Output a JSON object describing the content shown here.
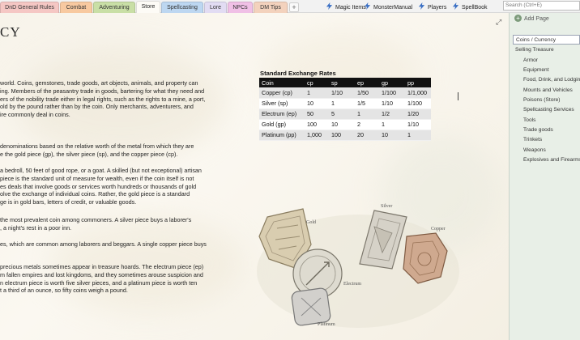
{
  "tabs": [
    {
      "label": "DnD General Rules",
      "color": "#f5c7c4"
    },
    {
      "label": "Combat",
      "color": "#f8c9a0"
    },
    {
      "label": "Adventuring",
      "color": "#c9dfa6"
    },
    {
      "label": "Store",
      "color": "#fdfbf6",
      "active": true
    },
    {
      "label": "Spellcasting",
      "color": "#bdd7f1"
    },
    {
      "label": "Lore",
      "color": "#e2dcf3"
    },
    {
      "label": "NPCs",
      "color": "#f0c0e6"
    },
    {
      "label": "DM Tips",
      "color": "#f3d2bd"
    }
  ],
  "add_tab_label": "+",
  "shortcuts": [
    {
      "label": "Magic Items",
      "icon": "lightning-icon"
    },
    {
      "label": "MonsterManual",
      "icon": "lightning-icon"
    },
    {
      "label": "Players",
      "icon": "lightning-icon"
    },
    {
      "label": "SpellBook",
      "icon": "lightning-icon"
    }
  ],
  "search": {
    "placeholder": "Search (Ctrl+E)"
  },
  "page": {
    "title": "CY",
    "paragraphs": [
      [
        "world. Coins, gemstones, trade goods, art objects, animals, and property can",
        "ing. Members of the peasantry trade in goods, bartering for what they need and",
        "ers of the nobility trade either in legal rights, such as the rights to a mine, a port,",
        "old by the pound rather than by the coin. Only merchants, adventurers, and",
        "ire commonly deal in coins."
      ],
      [
        "denominations based on the relative worth of the metal from which they are",
        "e the gold piece (gp), the silver piece (sp), and the copper piece (cp)."
      ],
      [
        "a bedroll, 50 feet of good rope, or a goat. A skilled (but not exceptional) artisan",
        "piece is the standard unit of measure for wealth, even if the coin itself is not",
        "es deals that involve goods or services worth hundreds or thousands of gold",
        "olve the exchange of individual coins. Rather, the gold piece is a standard",
        "ge is in gold bars, letters of credit, or valuable goods."
      ],
      [
        "the most prevalent coin among commoners. A silver piece buys a laborer's",
        ", a night's rest in a poor inn."
      ],
      [
        "es, which are common among laborers and beggars. A single copper piece buys"
      ],
      [
        "precious metals sometimes appear in treasure hoards. The electrum piece (ep)",
        "m fallen empires and lost kingdoms, and they sometimes arouse suspicion and",
        "n electrum piece is worth five silver pieces, and a platinum piece is worth ten",
        "t a third of an ounce, so fifty coins weigh a pound."
      ]
    ]
  },
  "exchange": {
    "title": "Standard Exchange Rates",
    "headers": [
      "Coin",
      "cp",
      "sp",
      "ep",
      "gp",
      "pp"
    ],
    "rows": [
      [
        "Copper (cp)",
        "1",
        "1/10",
        "1/50",
        "1/100",
        "1/1,000"
      ],
      [
        "Silver (sp)",
        "10",
        "1",
        "1/5",
        "1/10",
        "1/100"
      ],
      [
        "Electrum (ep)",
        "50",
        "5",
        "1",
        "1/2",
        "1/20"
      ],
      [
        "Gold (gp)",
        "100",
        "10",
        "2",
        "1",
        "1/10"
      ],
      [
        "Platinum (pp)",
        "1,000",
        "100",
        "20",
        "10",
        "1"
      ]
    ]
  },
  "coins_labels": {
    "gold": "Gold",
    "silver": "Silver",
    "copper": "Copper",
    "electrum": "Electrum",
    "platinum": "Platinum"
  },
  "sidebar": {
    "add_page": "Add Page",
    "items": [
      {
        "label": "Coins / Currency",
        "level": 0,
        "selected": true
      },
      {
        "label": "Selling Treasure",
        "level": 0
      },
      {
        "label": "Armor",
        "level": 1
      },
      {
        "label": "Equipment",
        "level": 1
      },
      {
        "label": "Food, Drink, and Lodging",
        "level": 1
      },
      {
        "label": "Mounts and Vehicles",
        "level": 1
      },
      {
        "label": "Poisons (Store)",
        "level": 1
      },
      {
        "label": "Spellcasting Services",
        "level": 1
      },
      {
        "label": "Tools",
        "level": 1
      },
      {
        "label": "Trade goods",
        "level": 1
      },
      {
        "label": "Trinkets",
        "level": 1
      },
      {
        "label": "Weapons",
        "level": 1
      },
      {
        "label": "Explosives and Firearms",
        "level": 1
      }
    ]
  }
}
